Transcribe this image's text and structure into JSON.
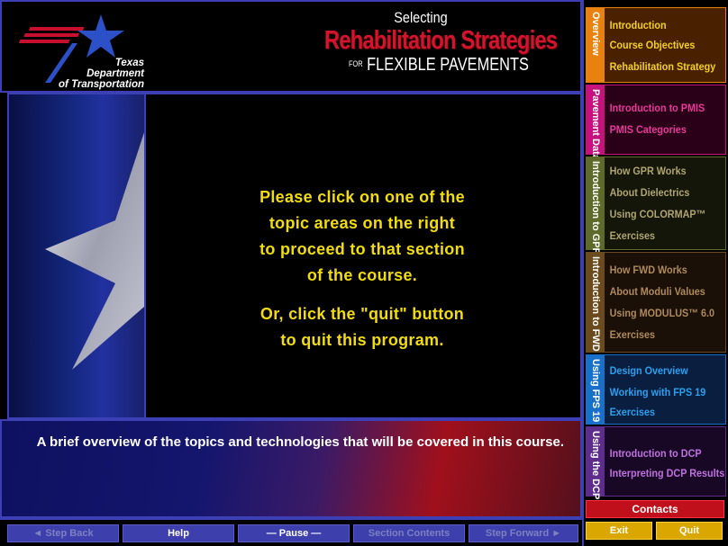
{
  "header": {
    "logo_text": "Texas\nDepartment\nof Transportation",
    "title_line1": "Selecting",
    "title_line2": "Rehabilitation Strategies",
    "title_line3_prefix": "FOR",
    "title_line3": "FLEXIBLE PAVEMENTS"
  },
  "main": {
    "message_lines": [
      "Please click on one of the",
      "topic areas on the right",
      "to proceed to that section",
      "of the course."
    ],
    "message_lines2": [
      "Or, click the \"quit\" button",
      "to quit this program."
    ]
  },
  "description": "A brief overview of the topics and technologies that will be covered in this course.",
  "navbar": {
    "step_back": "◄ Step Back",
    "help": "Help",
    "pause": "— Pause —",
    "section_contents": "Section Contents",
    "step_forward": "Step Forward ►"
  },
  "sidebar": {
    "sections": [
      {
        "tab": "Overview",
        "color": "#e8820e",
        "bg": "#4a2100",
        "item_color": "#f4d020",
        "items": [
          "Introduction",
          "Course Objectives",
          "Rehabilitation Strategy"
        ]
      },
      {
        "tab": "Pavement Data",
        "color": "#c4147c",
        "bg": "#2a0018",
        "item_color": "#e8389a",
        "items": [
          "Introduction to PMIS",
          "PMIS Categories"
        ]
      },
      {
        "tab": "Introduction to GPR",
        "color": "#5e6a2a",
        "bg": "#14160a",
        "item_color": "#b0a470",
        "items": [
          "How GPR Works",
          "About Dielectrics",
          "Using COLORMAP™",
          "Exercises"
        ]
      },
      {
        "tab": "Introduction to FWD",
        "color": "#6b4a1e",
        "bg": "#1a1008",
        "item_color": "#b08a5a",
        "items": [
          "How FWD Works",
          "About Moduli Values",
          "Using MODULUS™ 6.0",
          "Exercises"
        ]
      },
      {
        "tab": "Using FPS 19",
        "color": "#1a70c8",
        "bg": "#0a1e40",
        "item_color": "#2aa0f0",
        "items": [
          "Design Overview",
          "Working with FPS 19",
          "Exercises"
        ]
      },
      {
        "tab": "Using the DCP",
        "color": "#5e2c8a",
        "bg": "#180826",
        "item_color": "#c070e0",
        "items": [
          "Introduction to DCP",
          "Interpreting DCP Results"
        ]
      }
    ],
    "contacts": "Contacts",
    "exit": "Exit",
    "quit": "Quit"
  }
}
